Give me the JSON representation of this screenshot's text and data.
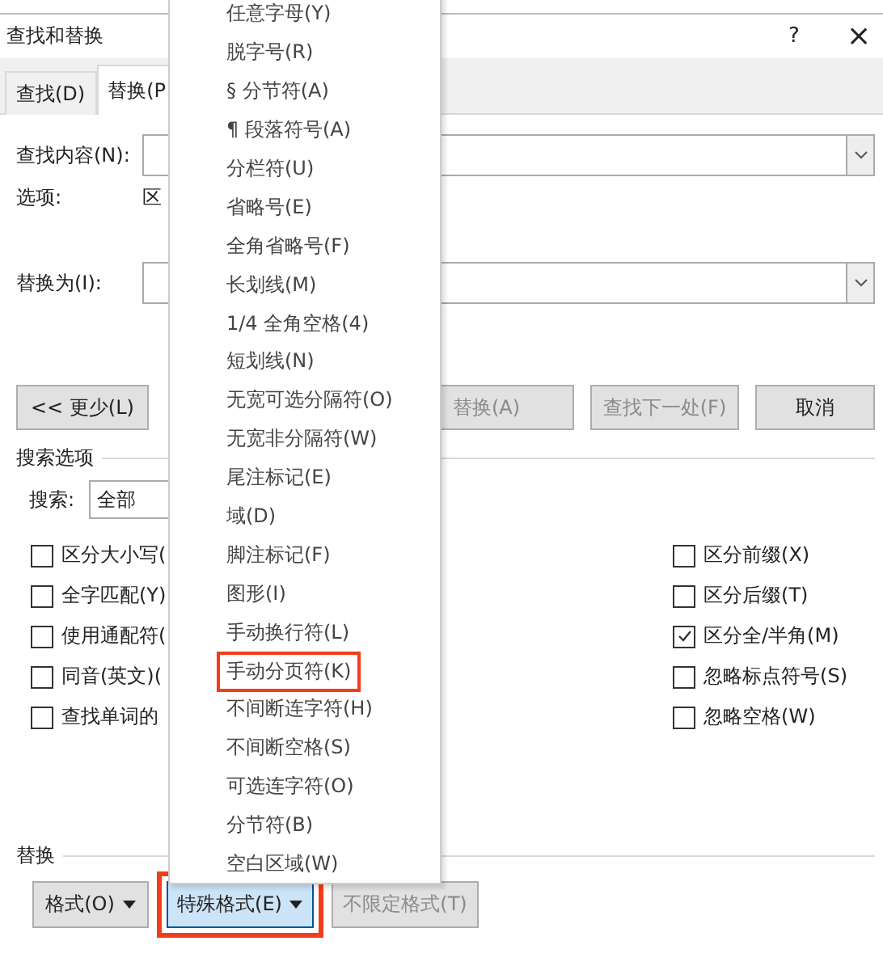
{
  "window": {
    "title": "查找和替换",
    "buttons": [
      {
        "kind": "help",
        "label": "?"
      },
      {
        "kind": "close",
        "label": "×"
      }
    ]
  },
  "tabs": [
    {
      "label": "查找(D)",
      "selected": false
    },
    {
      "label": "替换(P",
      "selected": true
    }
  ],
  "find": {
    "label": "查找内容(N):"
  },
  "options": {
    "label": "选项:",
    "value": "区"
  },
  "replace": {
    "label": "替换为(I):"
  },
  "action_buttons": [
    {
      "label": "<< 更少(L)",
      "disabled": false
    },
    {
      "label": "替换(A)",
      "disabled": true
    },
    {
      "label": "查找下一处(F)",
      "disabled": true
    },
    {
      "label": "取消",
      "disabled": false
    }
  ],
  "search_options": {
    "title": "搜索选项",
    "search_label": "搜索:",
    "search_value": "全部",
    "left_checks": [
      {
        "label": "区分大小写(",
        "checked": false
      },
      {
        "label": "全字匹配(Y)",
        "checked": false
      },
      {
        "label": "使用通配符(",
        "checked": false
      },
      {
        "label": "同音(英文)(",
        "checked": false
      },
      {
        "label": "查找单词的",
        "checked": false
      }
    ],
    "right_checks": [
      {
        "label": "区分前缀(X)",
        "checked": false
      },
      {
        "label": "区分后缀(T)",
        "checked": false
      },
      {
        "label": "区分全/半角(M)",
        "checked": true
      },
      {
        "label": "忽略标点符号(S)",
        "checked": false
      },
      {
        "label": "忽略空格(W)",
        "checked": false
      }
    ]
  },
  "replace_section": {
    "title": "替换",
    "buttons": [
      {
        "label": "格式(O)",
        "dropdown": true,
        "pressed": false,
        "disabled": false,
        "highlighted": false
      },
      {
        "label": "特殊格式(E)",
        "dropdown": true,
        "pressed": true,
        "disabled": false,
        "highlighted": true
      },
      {
        "label": "不限定格式(T)",
        "dropdown": false,
        "pressed": false,
        "disabled": true,
        "highlighted": false
      }
    ]
  },
  "menu": {
    "items": [
      {
        "label": "任意字母(Y)",
        "highlighted": false
      },
      {
        "label": "脱字号(R)",
        "highlighted": false
      },
      {
        "label": "§ 分节符(A)",
        "highlighted": false
      },
      {
        "label": "¶ 段落符号(A)",
        "highlighted": false
      },
      {
        "label": "分栏符(U)",
        "highlighted": false
      },
      {
        "label": "省略号(E)",
        "highlighted": false
      },
      {
        "label": "全角省略号(F)",
        "highlighted": false
      },
      {
        "label": "长划线(M)",
        "highlighted": false
      },
      {
        "label": "1/4 全角空格(4)",
        "highlighted": false
      },
      {
        "label": "短划线(N)",
        "highlighted": false
      },
      {
        "label": "无宽可选分隔符(O)",
        "highlighted": false
      },
      {
        "label": "无宽非分隔符(W)",
        "highlighted": false
      },
      {
        "label": "尾注标记(E)",
        "highlighted": false
      },
      {
        "label": "域(D)",
        "highlighted": false
      },
      {
        "label": "脚注标记(F)",
        "highlighted": false
      },
      {
        "label": "图形(I)",
        "highlighted": false
      },
      {
        "label": "手动换行符(L)",
        "highlighted": false
      },
      {
        "label": "手动分页符(K)",
        "highlighted": true
      },
      {
        "label": "不间断连字符(H)",
        "highlighted": false
      },
      {
        "label": "不间断空格(S)",
        "highlighted": false
      },
      {
        "label": "可选连字符(O)",
        "highlighted": false
      },
      {
        "label": "分节符(B)",
        "highlighted": false
      },
      {
        "label": "空白区域(W)",
        "highlighted": false
      }
    ]
  }
}
